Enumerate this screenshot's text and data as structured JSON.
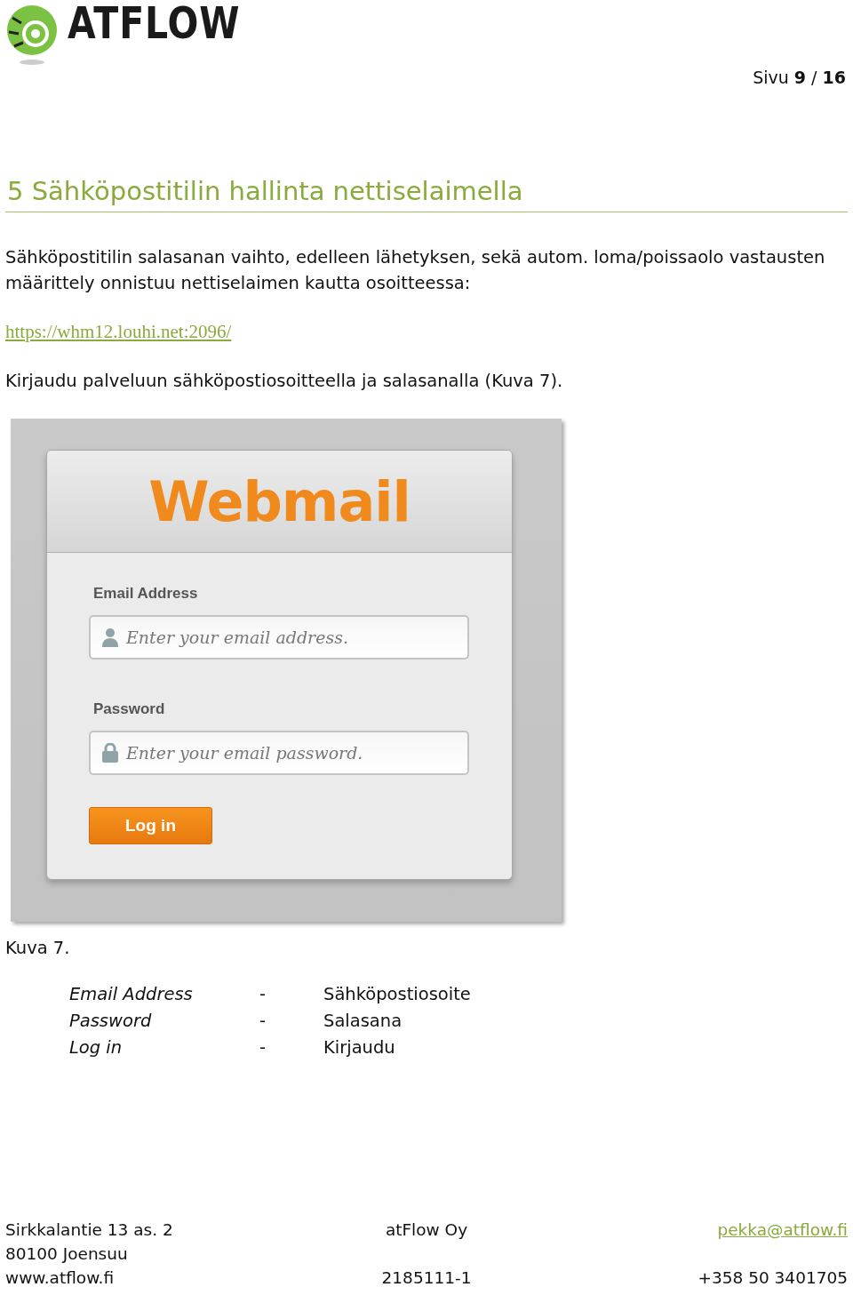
{
  "header": {
    "logo_text": "ATFLOW",
    "page_number": "Sivu **9** / **16**"
  },
  "section": {
    "title": "5 Sähköpostitilin hallinta nettiselaimella"
  },
  "paragraphs": [
    {
      "kind": "text",
      "text": "Sähköpostitilin salasanan vaihto, edelleen lähetyksen, sekä autom. loma/poissaolo vastausten määrittely onnistuu nettiselaimen kautta osoitteessa:"
    },
    {
      "kind": "link",
      "text": "https://whm12.louhi.net:2096/"
    },
    {
      "kind": "text",
      "text": "Kirjaudu palveluun sähköpostiosoitteella ja salasanalla (Kuva 7)."
    }
  ],
  "screenshot": {
    "logo": "Webmail",
    "fields": [
      {
        "label": "Email Address",
        "placeholder": "Enter your email address.",
        "kind": "user"
      },
      {
        "label": "Password",
        "placeholder": "Enter your email password.",
        "kind": "lock"
      }
    ],
    "button": "Log in"
  },
  "caption": "Kuva 7.",
  "legend": [
    {
      "term": "Email Address",
      "dash": "-",
      "meaning": "Sähköpostiosoite"
    },
    {
      "term": "Password",
      "dash": "-",
      "meaning": "Salasana"
    },
    {
      "term": "Log in",
      "dash": "-",
      "meaning": "Kirjaudu"
    }
  ],
  "footer": {
    "address": [
      "Sirkkalantie 13 as. 2",
      "80100 Joensuu",
      "www.atflow.fi"
    ],
    "company": "atFlow Oy",
    "business_id": "2185111-1",
    "email": "pekka@atflow.fi",
    "phone": "+358 50 3401705"
  }
}
